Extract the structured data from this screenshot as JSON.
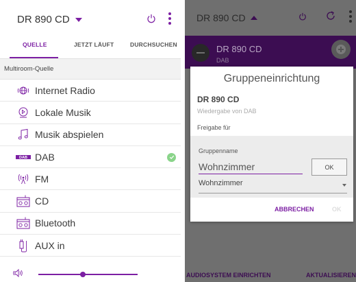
{
  "colors": {
    "accent": "#7c1fa3",
    "dark_purple": "#3c0d52",
    "check_green": "#8ad48a",
    "overlay_gray": "#6f6f6f"
  },
  "left": {
    "device_name": "DR 890 CD",
    "tabs": [
      {
        "label": "QUELLE",
        "active": true
      },
      {
        "label": "JETZT LÄUFT",
        "active": false
      },
      {
        "label": "DURCHSUCHEN",
        "active": false
      }
    ],
    "section_label": "Multiroom-Quelle",
    "sources": [
      {
        "label": "Internet Radio",
        "icon": "internet-radio-icon",
        "selected": false
      },
      {
        "label": "Lokale Musik",
        "icon": "local-music-icon",
        "selected": false
      },
      {
        "label": "Musik abspielen",
        "icon": "music-note-icon",
        "selected": false
      },
      {
        "label": "DAB",
        "icon": "dab-icon",
        "selected": true
      },
      {
        "label": "FM",
        "icon": "fm-icon",
        "selected": false
      },
      {
        "label": "CD",
        "icon": "cd-icon",
        "selected": false
      },
      {
        "label": "Bluetooth",
        "icon": "bluetooth-speaker-icon",
        "selected": false
      },
      {
        "label": "AUX in",
        "icon": "aux-plug-icon",
        "selected": false
      }
    ],
    "dab_icon_text": "DAB",
    "volume_level": 0.45
  },
  "right": {
    "device_name": "DR 890 CD",
    "band_device": "DR 890 CD",
    "band_source": "DAB",
    "dialog": {
      "title": "Gruppeneinrichtung",
      "device": "DR 890 CD",
      "subtitle": "Wiedergabe von DAB",
      "share_label": "Freigabe für",
      "group_name_label": "Gruppenname",
      "group_name_value": "Wohnzimmer",
      "ok_label": "OK",
      "select_value": "Wohnzimmer",
      "cancel_label": "ABBRECHEN",
      "confirm_label": "OK"
    },
    "footer": {
      "setup_label": "AUDIOSYSTEM EINRICHTEN",
      "refresh_label": "AKTUALISIEREN"
    }
  }
}
